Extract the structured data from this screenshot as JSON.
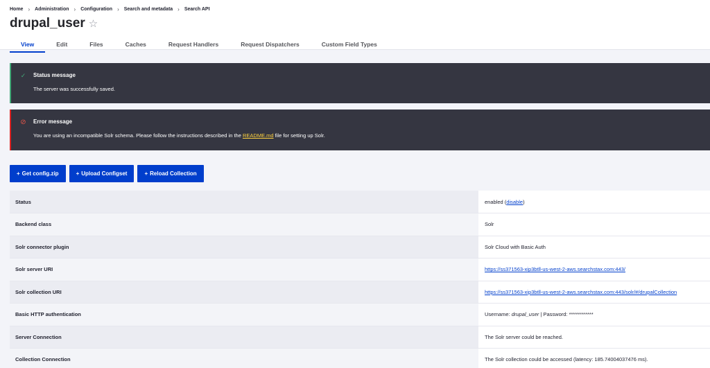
{
  "breadcrumb": [
    "Home",
    "Administration",
    "Configuration",
    "Search and metadata",
    "Search API"
  ],
  "page": {
    "title": "drupal_user"
  },
  "tabs": [
    {
      "label": "View"
    },
    {
      "label": "Edit"
    },
    {
      "label": "Files"
    },
    {
      "label": "Caches"
    },
    {
      "label": "Request Handlers"
    },
    {
      "label": "Request Dispatchers"
    },
    {
      "label": "Custom Field Types"
    }
  ],
  "status_message": {
    "heading": "Status message",
    "text": "The server was successfully saved."
  },
  "error_message": {
    "heading": "Error message",
    "text_before": "You are using an incompatible Solr schema. Please follow the instructions described in the ",
    "link": "README.md",
    "text_after": " file for setting up Solr."
  },
  "buttons": [
    {
      "label": "Get config.zip"
    },
    {
      "label": "Upload Configset"
    },
    {
      "label": "Reload Collection"
    }
  ],
  "rows": [
    {
      "label": "Status",
      "value": "enabled (",
      "link": "disable",
      "after": ")"
    },
    {
      "label": "Backend class",
      "value": "Solr"
    },
    {
      "label": "Solr connector plugin",
      "value": "Solr Cloud with Basic Auth"
    },
    {
      "label": "Solr server URI",
      "link": "https://ss371563-xip3btll-us-west-2-aws.searchstax.com:443/"
    },
    {
      "label": "Solr collection URI",
      "link": "https://ss371563-xip3btll-us-west-2-aws.searchstax.com:443/solr/#/drupalCollection"
    },
    {
      "label": "Basic HTTP authentication",
      "value": "Username: ",
      "em": "drupal_user",
      "after": " | Password: ************"
    },
    {
      "label": "Server Connection",
      "value": "The Solr server could be reached."
    },
    {
      "label": "Collection Connection",
      "value": "The Solr collection could be accessed (latency: 185.74004037476 ms)."
    }
  ],
  "colors": {
    "accent": "#003ecc",
    "status": "#42a877",
    "error": "#dc2323",
    "message_bg": "#353641"
  }
}
